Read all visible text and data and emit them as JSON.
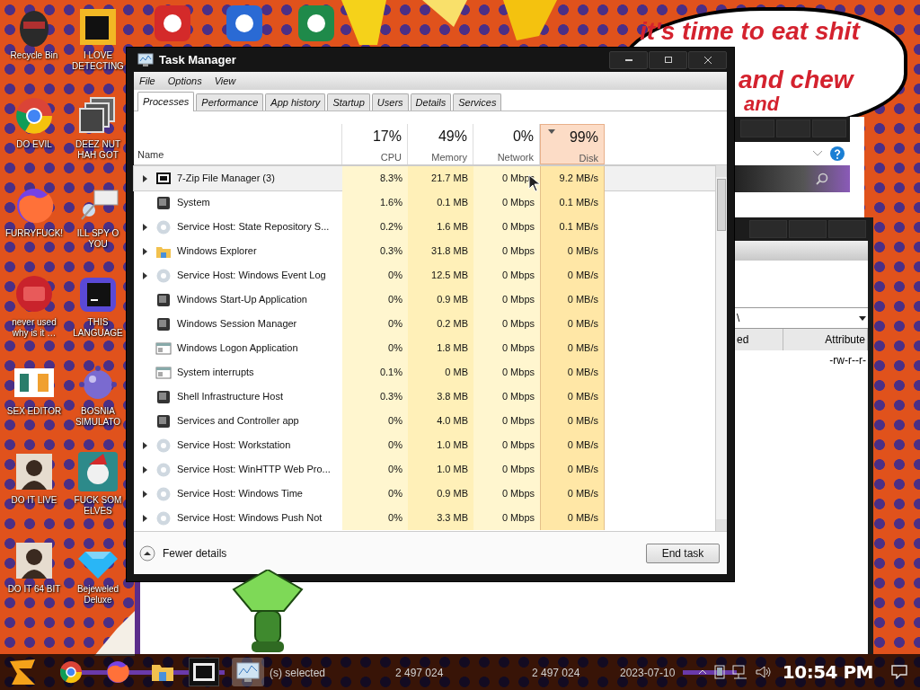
{
  "desktop_icons": [
    {
      "label": "Recycle Bin",
      "kind": "bin"
    },
    {
      "label": "I LOVE DETECTING",
      "kind": "de"
    },
    {
      "label": "DO EVIL",
      "kind": "chrome"
    },
    {
      "label": "DEEZ NUT HAH GOT",
      "kind": "stack"
    },
    {
      "label": "FURRYFUCK!",
      "kind": "firefox"
    },
    {
      "label": "ILL SPY O YOU",
      "kind": "spy"
    },
    {
      "label": "never used why is it …",
      "kind": "dev"
    },
    {
      "label": "THIS LANGUAGE",
      "kind": "go"
    },
    {
      "label": "SEX EDITOR",
      "kind": "hex"
    },
    {
      "label": "BOSNIA SIMULATO",
      "kind": "mine"
    },
    {
      "label": "DO IT LIVE",
      "kind": "portrait"
    },
    {
      "label": "FUCK SOM ELVES",
      "kind": "elf"
    },
    {
      "label": "DO IT 64 BIT",
      "kind": "portrait"
    },
    {
      "label": "Bejeweled Deluxe",
      "kind": "gem"
    }
  ],
  "speech_bubble": {
    "lines": [
      "it's time to eat shit",
      "and chew",
      "and"
    ]
  },
  "task_manager": {
    "title": "Task Manager",
    "menu": [
      "File",
      "Options",
      "View"
    ],
    "tabs": [
      {
        "label": "Processes",
        "selected": true
      },
      {
        "label": "Performance",
        "selected": false
      },
      {
        "label": "App history",
        "selected": false
      },
      {
        "label": "Startup",
        "selected": false
      },
      {
        "label": "Users",
        "selected": false
      },
      {
        "label": "Details",
        "selected": false
      },
      {
        "label": "Services",
        "selected": false
      }
    ],
    "name_column": "Name",
    "columns": [
      {
        "percent": "17%",
        "label": "CPU",
        "sorted": false
      },
      {
        "percent": "49%",
        "label": "Memory",
        "sorted": false
      },
      {
        "percent": "0%",
        "label": "Network",
        "sorted": false
      },
      {
        "percent": "99%",
        "label": "Disk",
        "sorted": true
      }
    ],
    "rows": [
      {
        "name": "7-Zip File Manager (3)",
        "kind": "archive",
        "expandable": true,
        "selected": true,
        "values": [
          "8.3%",
          "21.7 MB",
          "0 Mbps",
          "9.2 MB/s"
        ]
      },
      {
        "name": "System",
        "kind": "system",
        "expandable": false,
        "selected": false,
        "values": [
          "1.6%",
          "0.1 MB",
          "0 Mbps",
          "0.1 MB/s"
        ]
      },
      {
        "name": "Service Host: State Repository S...",
        "kind": "gear",
        "expandable": true,
        "selected": false,
        "values": [
          "0.2%",
          "1.6 MB",
          "0 Mbps",
          "0.1 MB/s"
        ]
      },
      {
        "name": "Windows Explorer",
        "kind": "folder",
        "expandable": true,
        "selected": false,
        "values": [
          "0.3%",
          "31.8 MB",
          "0 Mbps",
          "0 MB/s"
        ]
      },
      {
        "name": "Service Host: Windows Event Log",
        "kind": "gear",
        "expandable": true,
        "selected": false,
        "values": [
          "0%",
          "12.5 MB",
          "0 Mbps",
          "0 MB/s"
        ]
      },
      {
        "name": "Windows Start-Up Application",
        "kind": "system",
        "expandable": false,
        "selected": false,
        "values": [
          "0%",
          "0.9 MB",
          "0 Mbps",
          "0 MB/s"
        ]
      },
      {
        "name": "Windows Session Manager",
        "kind": "system",
        "expandable": false,
        "selected": false,
        "values": [
          "0%",
          "0.2 MB",
          "0 Mbps",
          "0 MB/s"
        ]
      },
      {
        "name": "Windows Logon Application",
        "kind": "window",
        "expandable": false,
        "selected": false,
        "values": [
          "0%",
          "1.8 MB",
          "0 Mbps",
          "0 MB/s"
        ]
      },
      {
        "name": "System interrupts",
        "kind": "window",
        "expandable": false,
        "selected": false,
        "values": [
          "0.1%",
          "0 MB",
          "0 Mbps",
          "0 MB/s"
        ]
      },
      {
        "name": "Shell Infrastructure Host",
        "kind": "system",
        "expandable": false,
        "selected": false,
        "values": [
          "0.3%",
          "3.8 MB",
          "0 Mbps",
          "0 MB/s"
        ]
      },
      {
        "name": "Services and Controller app",
        "kind": "system",
        "expandable": false,
        "selected": false,
        "values": [
          "0%",
          "4.0 MB",
          "0 Mbps",
          "0 MB/s"
        ]
      },
      {
        "name": "Service Host: Workstation",
        "kind": "gear",
        "expandable": true,
        "selected": false,
        "values": [
          "0%",
          "1.0 MB",
          "0 Mbps",
          "0 MB/s"
        ]
      },
      {
        "name": "Service Host: WinHTTP Web Pro...",
        "kind": "gear",
        "expandable": true,
        "selected": false,
        "values": [
          "0%",
          "1.0 MB",
          "0 Mbps",
          "0 MB/s"
        ]
      },
      {
        "name": "Service Host: Windows Time",
        "kind": "gear",
        "expandable": true,
        "selected": false,
        "values": [
          "0%",
          "0.9 MB",
          "0 Mbps",
          "0 MB/s"
        ]
      },
      {
        "name": "Service Host: Windows Push Not",
        "kind": "gear",
        "expandable": true,
        "selected": false,
        "values": [
          "0%",
          "3.3 MB",
          "0 Mbps",
          "0 MB/s"
        ]
      }
    ],
    "fewer_details": "Fewer details",
    "end_task": "End task"
  },
  "file_window": {
    "path": "\\",
    "columns": [
      "ed",
      "Attribute"
    ],
    "cells": [
      "-rw-r--r-"
    ],
    "status": [
      "(s) selected",
      "2 497 024",
      "2 497 024",
      "2023-07-10"
    ]
  },
  "taskbar": {
    "apps": [
      {
        "kind": "start"
      },
      {
        "kind": "chrome"
      },
      {
        "kind": "firefox"
      },
      {
        "kind": "folder"
      },
      {
        "kind": "archive"
      },
      {
        "kind": "taskmgr"
      }
    ],
    "clock": "10:54 PM"
  }
}
